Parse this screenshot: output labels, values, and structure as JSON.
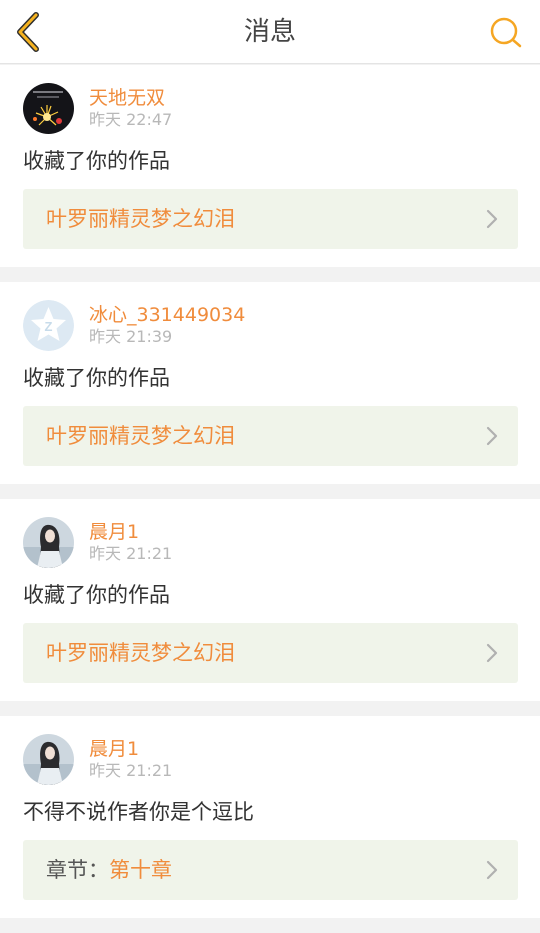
{
  "header": {
    "title": "消息",
    "back_icon": "chevron-left-icon",
    "search_icon": "search-icon",
    "accent_color": "#f5a623"
  },
  "messages": [
    {
      "username": "天地无双",
      "time": "昨天 22:47",
      "action": "收藏了你的作品",
      "work_title": "叶罗丽精灵梦之幻泪",
      "avatar": "fireworks-avatar"
    },
    {
      "username": "冰心_331449034",
      "time": "昨天 21:39",
      "action": "收藏了你的作品",
      "work_title": "叶罗丽精灵梦之幻泪",
      "avatar": "default-star-avatar"
    },
    {
      "username": "晨月1",
      "time": "昨天 21:21",
      "action": "收藏了你的作品",
      "work_title": "叶罗丽精灵梦之幻泪",
      "avatar": "girl-photo-avatar"
    },
    {
      "username": "晨月1",
      "time": "昨天 21:21",
      "action": "不得不说作者你是个逗比",
      "chapter_prefix": "章节：",
      "chapter_name": "第十章",
      "avatar": "girl-photo-avatar"
    }
  ],
  "colors": {
    "username": "#f08c3c",
    "link_bg": "#f0f4ea",
    "time": "#b8b8b8"
  }
}
